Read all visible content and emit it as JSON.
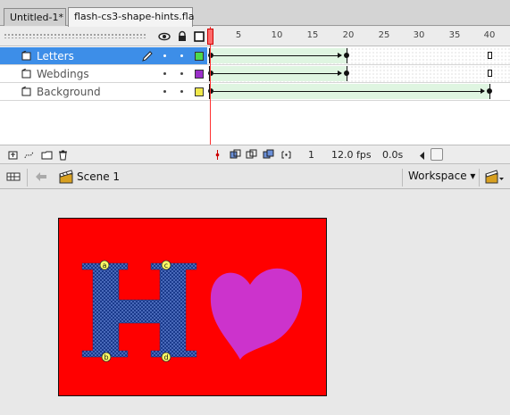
{
  "tabs": [
    {
      "label": "Untitled-1*",
      "active": false
    },
    {
      "label": "flash-cs3-shape-hints.fla",
      "active": true
    }
  ],
  "timeline": {
    "header_icons": [
      "eye-icon",
      "lock-icon",
      "outline-icon"
    ],
    "ruler": [
      "1",
      "5",
      "10",
      "15",
      "20",
      "25",
      "30",
      "35",
      "40"
    ],
    "current_frame": 1,
    "layers": [
      {
        "name": "Letters",
        "selected": true,
        "color": "#4ddb4d",
        "tween_end_frame": 20
      },
      {
        "name": "Webdings",
        "selected": false,
        "color": "#9b2fc9",
        "tween_end_frame": 20
      },
      {
        "name": "Background",
        "selected": false,
        "color": "#f0e84a",
        "tween_end_frame": 40
      }
    ],
    "footer": {
      "frame": "1",
      "fps": "12.0 fps",
      "time": "0.0s"
    }
  },
  "editbar": {
    "back_icon": "arrow-left-icon",
    "scene_label": "Scene 1",
    "workspace_label": "Workspace",
    "workspace_arrow": "▾"
  },
  "stage": {
    "background_color": "#ff0000",
    "letter": "H",
    "letter_color": "#1a3a8c",
    "heart_color": "#cc33cc",
    "hint_labels": [
      "a",
      "b",
      "c",
      "d"
    ]
  }
}
